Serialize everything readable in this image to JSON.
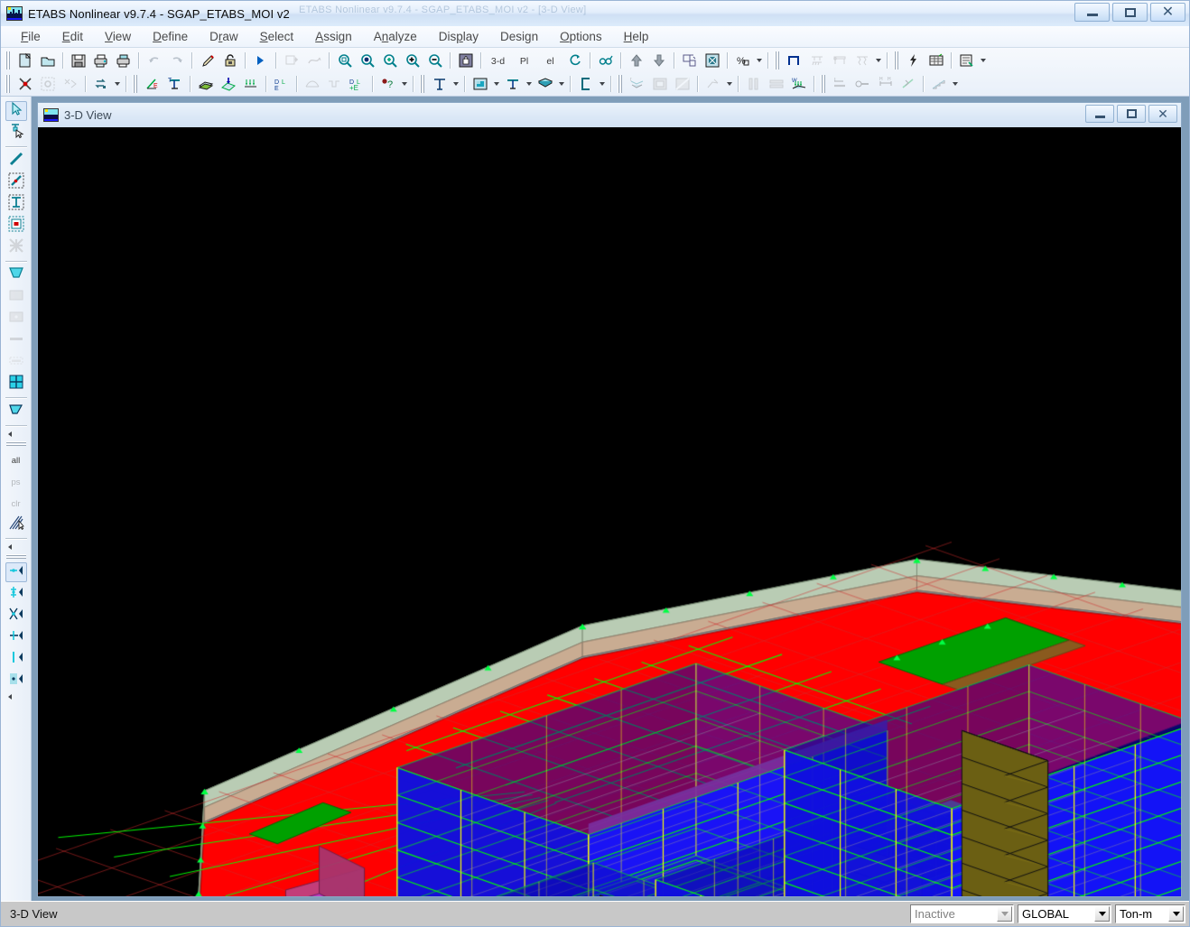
{
  "window": {
    "title": "ETABS Nonlinear v9.7.4 - SGAP_ETABS_MOI v2",
    "ghost_title": "ETABS Nonlinear v9.7.4 - SGAP_ETABS_MOI v2 - [3-D View]",
    "app_icon": "etabs-building-icon",
    "minimize_label": "Minimize",
    "maximize_label": "Maximize",
    "close_label": "Close"
  },
  "menubar": {
    "items": [
      {
        "label": "File",
        "accel": "F"
      },
      {
        "label": "Edit",
        "accel": "E"
      },
      {
        "label": "View",
        "accel": "V"
      },
      {
        "label": "Define",
        "accel": "D"
      },
      {
        "label": "Draw",
        "accel": "r"
      },
      {
        "label": "Select",
        "accel": "S"
      },
      {
        "label": "Assign",
        "accel": "A"
      },
      {
        "label": "Analyze",
        "accel": "n"
      },
      {
        "label": "Display",
        "accel": "p"
      },
      {
        "label": "Design",
        "accel": "g"
      },
      {
        "label": "Options",
        "accel": "O"
      },
      {
        "label": "Help",
        "accel": "H"
      }
    ]
  },
  "toolbar_row1": [
    {
      "name": "new-model-button",
      "tip": "New Model",
      "icon": "new-file-icon",
      "enabled": true
    },
    {
      "name": "open-model-button",
      "tip": "Open File",
      "icon": "open-folder-icon",
      "enabled": true
    },
    {
      "name": "save-model-button",
      "tip": "Save Model",
      "icon": "floppy-save-icon",
      "enabled": true
    },
    {
      "name": "print-preview-button",
      "tip": "Print Graphics",
      "icon": "printer-preview-icon",
      "enabled": true
    },
    {
      "name": "print-button",
      "tip": "Print Tables",
      "icon": "printer-icon",
      "enabled": true
    },
    {
      "name": "undo-button",
      "tip": "Undo",
      "icon": "undo-arrow-icon",
      "enabled": false
    },
    {
      "name": "redo-button",
      "tip": "Redo",
      "icon": "redo-arrow-icon",
      "enabled": false
    },
    {
      "name": "edit-mode-button",
      "tip": "Edit Grid",
      "icon": "pencil-icon",
      "enabled": true
    },
    {
      "name": "lock-model-button",
      "tip": "Lock/Unlock Model",
      "icon": "padlock-icon",
      "enabled": true
    },
    {
      "name": "run-analysis-button",
      "tip": "Run Analysis",
      "icon": "run-arrow-icon",
      "enabled": true
    },
    {
      "name": "run-static-button",
      "tip": "Run Static Analysis",
      "icon": "frame-run-icon",
      "enabled": false
    },
    {
      "name": "deformed-shape-button",
      "tip": "Show Deformed Shape",
      "icon": "deformed-shape-icon",
      "enabled": false
    },
    {
      "name": "zoom-window-button",
      "tip": "Rubber Band Zoom",
      "icon": "zoom-window-icon",
      "enabled": true
    },
    {
      "name": "zoom-previous-button",
      "tip": "Restore Full View",
      "icon": "zoom-full-icon",
      "enabled": true
    },
    {
      "name": "zoom-in-button",
      "tip": "Zoom In One Step",
      "icon": "zoom-in-icon",
      "enabled": true
    },
    {
      "name": "zoom-in-step-button",
      "tip": "Zoom In",
      "icon": "zoom-plus-icon",
      "enabled": true
    },
    {
      "name": "zoom-out-button",
      "tip": "Zoom Out One Step",
      "icon": "zoom-minus-icon",
      "enabled": true
    },
    {
      "name": "pan-button",
      "tip": "Pan",
      "icon": "hand-pan-icon",
      "enabled": true
    },
    {
      "name": "view-3d-button",
      "tip": "3-D View",
      "icon": "view-3d-icon",
      "enabled": true,
      "text": "3-d"
    },
    {
      "name": "view-plan-button",
      "tip": "Plan View",
      "icon": "view-plan-icon",
      "enabled": true,
      "text": "Pl"
    },
    {
      "name": "view-elevation-button",
      "tip": "Elevation View",
      "icon": "view-elevation-icon",
      "enabled": true,
      "text": "el"
    },
    {
      "name": "rotate-3d-button",
      "tip": "Set 3D View",
      "icon": "rotate-3d-icon",
      "enabled": true
    },
    {
      "name": "perspective-button",
      "tip": "Perspective Toggle",
      "icon": "perspective-icon",
      "enabled": true
    },
    {
      "name": "story-up-button",
      "tip": "Move Up In List",
      "icon": "arrow-up-icon",
      "enabled": true
    },
    {
      "name": "story-down-button",
      "tip": "Move Down In List",
      "icon": "arrow-down-icon",
      "enabled": true
    },
    {
      "name": "set-building-view-button",
      "tip": "Set Building View Options",
      "icon": "building-view-icon",
      "enabled": true
    },
    {
      "name": "display-options-button",
      "tip": "Object Shrink Toggle",
      "icon": "shrink-objects-icon",
      "enabled": true
    },
    {
      "name": "scale-button",
      "tip": "Set Display Scale",
      "icon": "percent-scale-icon",
      "enabled": true
    },
    {
      "name": "draw-frame-button",
      "tip": "Draw Frame Element",
      "icon": "draw-portal-icon",
      "enabled": true
    },
    {
      "name": "assign-restraint-button",
      "tip": "Assign Restraints",
      "icon": "restraint-icon",
      "enabled": false
    },
    {
      "name": "assign-frame-rel-button",
      "tip": "Frame Releases",
      "icon": "frame-release-icon",
      "enabled": false
    },
    {
      "name": "assign-spring-button",
      "tip": "Assign Springs",
      "icon": "spring-support-icon",
      "enabled": false
    },
    {
      "name": "quick-load-button",
      "tip": "Quick Load",
      "icon": "lightning-icon",
      "enabled": true
    },
    {
      "name": "show-tables-button",
      "tip": "Show Tables",
      "icon": "table-grid-icon",
      "enabled": true
    },
    {
      "name": "show-report-button",
      "tip": "Create Report",
      "icon": "report-icon",
      "enabled": true
    }
  ],
  "toolbar_row2": [
    {
      "name": "select-pointer-button",
      "tip": "Select Object",
      "icon": "select-cross-icon",
      "enabled": true
    },
    {
      "name": "select-all-window-button",
      "tip": "Select All In Window",
      "icon": "select-window-icon",
      "enabled": false
    },
    {
      "name": "deselect-button",
      "tip": "Clear Selection",
      "icon": "deselect-icon",
      "enabled": false
    },
    {
      "name": "move-object-button",
      "tip": "Move Points/Objects",
      "icon": "move-object-icon",
      "enabled": true
    },
    {
      "name": "assign-section-button",
      "tip": "Assign Frame Section",
      "icon": "frame-section-icon",
      "enabled": true
    },
    {
      "name": "assign-wall-button",
      "tip": "Assign Wall/Slab",
      "icon": "wall-slab-icon",
      "enabled": true
    },
    {
      "name": "assign-area-button",
      "tip": "Assign Area Section",
      "icon": "area-section-icon",
      "enabled": true
    },
    {
      "name": "assign-load-button",
      "tip": "Assign Point Load",
      "icon": "point-load-icon",
      "enabled": true
    },
    {
      "name": "assign-dist-load-button",
      "tip": "Assign Frame Load",
      "icon": "distributed-load-icon",
      "enabled": true
    },
    {
      "name": "show-loads-button",
      "tip": "Show Loads",
      "icon": "show-loads-icon",
      "enabled": true
    },
    {
      "name": "show-moment-button",
      "tip": "Moment Diagram",
      "icon": "moment-diagram-icon",
      "enabled": false
    },
    {
      "name": "show-shear-button",
      "tip": "Shear Diagram",
      "icon": "shear-diagram-icon",
      "enabled": false
    },
    {
      "name": "design-overwrite-button",
      "tip": "Design Overwrites",
      "icon": "design-overwrite-icon",
      "enabled": true
    },
    {
      "name": "identify-object-button",
      "tip": "Object Information",
      "icon": "info-query-icon",
      "enabled": true
    },
    {
      "name": "label-text-button",
      "tip": "Set Label Display",
      "icon": "text-label-icon",
      "enabled": true
    },
    {
      "name": "fill-objects-button",
      "tip": "Fill Objects Toggle",
      "icon": "fill-objects-icon",
      "enabled": true
    },
    {
      "name": "extrude-view-button",
      "tip": "Extrude View Toggle",
      "icon": "extrude-view-icon",
      "enabled": true
    },
    {
      "name": "support-display-button",
      "tip": "Show Supports",
      "icon": "support-display-icon",
      "enabled": true
    },
    {
      "name": "section-cut-button",
      "tip": "Section Cut",
      "icon": "section-cut-icon",
      "enabled": true
    },
    {
      "name": "load-combo-button",
      "tip": "Display Load Combo",
      "icon": "load-combo-icon",
      "enabled": false
    },
    {
      "name": "mesh-display-button",
      "tip": "Show Mesh",
      "icon": "mesh-display-icon",
      "enabled": false
    },
    {
      "name": "area-fill-button",
      "tip": "Area Fill Toggle",
      "icon": "area-fill-icon",
      "enabled": false
    },
    {
      "name": "assign-mesh-button",
      "tip": "Auto Mesh Assign",
      "icon": "auto-mesh-icon",
      "enabled": false
    },
    {
      "name": "pier-label-button",
      "tip": "Pier Labels",
      "icon": "pier-label-icon",
      "enabled": false
    },
    {
      "name": "spandrel-label-button",
      "tip": "Spandrel Labels",
      "icon": "spandrel-label-icon",
      "enabled": false
    },
    {
      "name": "wall-load-button",
      "tip": "Wall Load Display",
      "icon": "wall-load-icon",
      "enabled": true
    },
    {
      "name": "tendon-button",
      "tip": "Tendon Layout",
      "icon": "tendon-icon",
      "enabled": false
    },
    {
      "name": "line-spring-button",
      "tip": "Line Spring",
      "icon": "line-spring-icon",
      "enabled": false
    },
    {
      "name": "end-length-button",
      "tip": "End Length Offsets",
      "icon": "end-offset-icon",
      "enabled": false
    },
    {
      "name": "hinge-button",
      "tip": "Frame Hinges",
      "icon": "hinge-icon",
      "enabled": false
    },
    {
      "name": "stair-button",
      "tip": "Staircase Tool",
      "icon": "stair-icon",
      "enabled": false
    }
  ],
  "side_toolbar": [
    {
      "name": "sidebar-pointer-tool",
      "tip": "Set Select Mode",
      "icon": "arrow-pointer-icon",
      "active": true,
      "enabled": true
    },
    {
      "name": "sidebar-reshape-tool",
      "tip": "Reshape Object",
      "icon": "reshape-pointer-icon",
      "active": false,
      "enabled": true
    },
    {
      "name": "sidebar-draw-line-tool",
      "tip": "Draw Lines",
      "icon": "draw-line-icon",
      "active": false,
      "enabled": true
    },
    {
      "name": "sidebar-draw-line-point-tool",
      "tip": "Draw Lines At Point",
      "icon": "draw-line-point-icon",
      "active": false,
      "enabled": true
    },
    {
      "name": "sidebar-draw-column-tool",
      "tip": "Create Columns In Region",
      "icon": "draw-column-icon",
      "active": false,
      "enabled": true
    },
    {
      "name": "sidebar-draw-secondary-tool",
      "tip": "Create Secondary Beams",
      "icon": "draw-secondary-icon",
      "active": false,
      "enabled": true
    },
    {
      "name": "sidebar-draw-brace-tool",
      "tip": "Draw Braces",
      "icon": "draw-brace-icon",
      "active": false,
      "enabled": false
    },
    {
      "name": "sidebar-draw-area-tool",
      "tip": "Draw Areas",
      "icon": "draw-area-icon",
      "active": false,
      "enabled": true
    },
    {
      "name": "sidebar-draw-rect-area-tool",
      "tip": "Draw Rectangular Areas",
      "icon": "draw-rect-area-icon",
      "active": false,
      "enabled": false
    },
    {
      "name": "sidebar-draw-quick-area-tool",
      "tip": "Quick Draw Areas",
      "icon": "quick-draw-area-icon",
      "active": false,
      "enabled": false
    },
    {
      "name": "sidebar-draw-wall-tool",
      "tip": "Draw Walls",
      "icon": "draw-wall-icon",
      "active": false,
      "enabled": false
    },
    {
      "name": "sidebar-draw-opening-tool",
      "tip": "Draw Openings",
      "icon": "draw-opening-icon",
      "active": false,
      "enabled": false
    },
    {
      "name": "sidebar-draw-floor-tool",
      "tip": "Draw Floor Mesh",
      "icon": "draw-floor-mesh-icon",
      "active": false,
      "enabled": true
    },
    {
      "name": "sidebar-draw-ramp-tool",
      "tip": "Draw Ramp",
      "icon": "draw-ramp-icon",
      "active": false,
      "enabled": true
    },
    {
      "name": "sidebar-select-all-tool",
      "tip": "Select All",
      "icon": "select-all-icon",
      "active": false,
      "enabled": true,
      "text": "all"
    },
    {
      "name": "sidebar-previous-select-tool",
      "tip": "Get Previous Selection",
      "icon": "previous-select-icon",
      "active": false,
      "enabled": false,
      "text": "ps"
    },
    {
      "name": "sidebar-clear-select-tool",
      "tip": "Clear Selection",
      "icon": "clear-select-icon",
      "active": false,
      "enabled": false,
      "text": "clr"
    },
    {
      "name": "sidebar-intersect-select-tool",
      "tip": "Select Using Intersecting Line",
      "icon": "intersecting-line-icon",
      "active": false,
      "enabled": true
    },
    {
      "name": "sidebar-snap-point-tool",
      "tip": "Snap To Points",
      "icon": "snap-point-icon",
      "active": true,
      "enabled": true
    },
    {
      "name": "sidebar-snap-grid-tool",
      "tip": "Snap To Grid Intersections",
      "icon": "snap-grid-icon",
      "active": false,
      "enabled": true
    },
    {
      "name": "sidebar-snap-intersect-tool",
      "tip": "Snap To Line Intersections",
      "icon": "snap-intersection-icon",
      "active": false,
      "enabled": true
    },
    {
      "name": "sidebar-snap-mid-tool",
      "tip": "Snap To Line Ends And Midpoints",
      "icon": "snap-midpoint-icon",
      "active": false,
      "enabled": true
    },
    {
      "name": "sidebar-snap-perp-tool",
      "tip": "Snap To Perpendicular",
      "icon": "snap-perpendicular-icon",
      "active": false,
      "enabled": true
    },
    {
      "name": "sidebar-snap-fine-tool",
      "tip": "Snap To Fine Grid",
      "icon": "snap-fine-grid-icon",
      "active": false,
      "enabled": true
    }
  ],
  "child_window": {
    "title": "3-D View",
    "icon": "etabs-building-icon",
    "minimize_label": "Minimize",
    "restore_label": "Restore",
    "close_label": "Close"
  },
  "statusbar": {
    "message": "3-D View",
    "animation_combo": {
      "name": "animation-state-combo",
      "value": "Inactive",
      "enabled": false
    },
    "coord_combo": {
      "name": "coordinate-system-combo",
      "value": "GLOBAL",
      "enabled": true
    },
    "units_combo": {
      "name": "units-combo",
      "value": "Ton-m",
      "enabled": true
    }
  },
  "model_view": {
    "background": "#000000",
    "colors": {
      "shell_tower": "#1414ff",
      "shell_podium": "#ff0000",
      "shell_core": "#d6cc33",
      "frame_line": "#00ff00",
      "frame_line_alt": "#ffff00",
      "basement_tan": "#c9ac92",
      "basement_green": "#9ec99a",
      "green_patch": "#00a000",
      "magenta_box": "#c040c0",
      "grid_grey": "#8a8aa0",
      "support_green": "#00ff44"
    }
  }
}
